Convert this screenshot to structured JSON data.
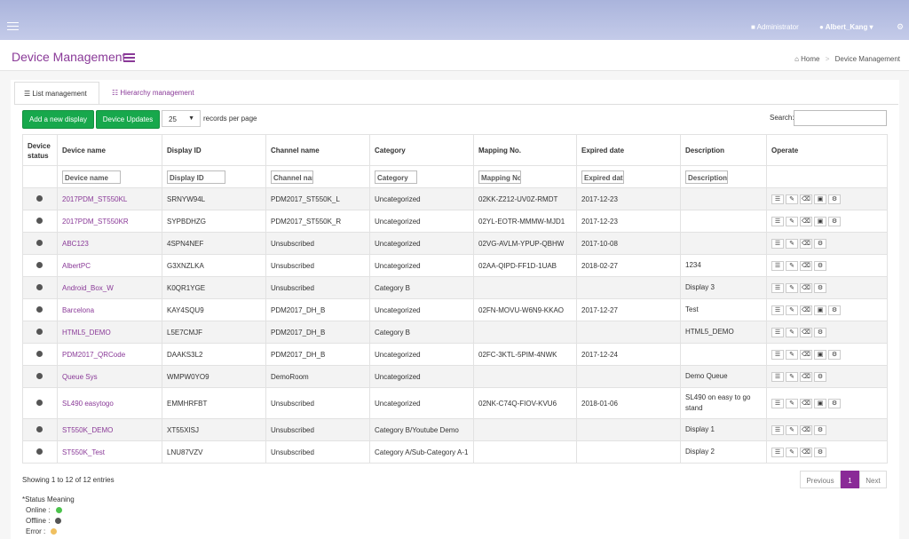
{
  "header": {
    "admin_label": "Administrator",
    "user_label": "Albert_Kang",
    "page_title": "Device Management",
    "breadcrumb": {
      "home": "Home",
      "current": "Device Management"
    }
  },
  "tabs": [
    {
      "label": "List management",
      "active": true
    },
    {
      "label": "Hierarchy management",
      "active": false
    }
  ],
  "toolbar": {
    "add_label": "Add a new display",
    "update_label": "Device Updates",
    "page_size": "25",
    "records_label": "records per page",
    "search_label": "Search:"
  },
  "columns": [
    "Device status",
    "Device name",
    "Display ID",
    "Channel name",
    "Category",
    "Mapping No.",
    "Expired date",
    "Description",
    "Operate"
  ],
  "filters": {
    "name": "Device name",
    "display_id": "Display ID",
    "channel": "Channel name",
    "category": "Category",
    "mapping": "Mapping No.",
    "expired": "Expired date",
    "description": "Description"
  },
  "rows": [
    {
      "name": "2017PDM_ST550KL",
      "display_id": "SRNYW94L",
      "channel": "PDM2017_ST550K_L",
      "category": "Uncategorized",
      "mapping": "02KK-Z212-UV0Z-RMDT",
      "expired": "2017-12-23",
      "description": ""
    },
    {
      "name": "2017PDM_ST550KR",
      "display_id": "SYPBDHZG",
      "channel": "PDM2017_ST550K_R",
      "category": "Uncategorized",
      "mapping": "02YL-EOTR-MMMW-MJD1",
      "expired": "2017-12-23",
      "description": ""
    },
    {
      "name": "ABC123",
      "display_id": "4SPN4NEF",
      "channel": "Unsubscribed",
      "category": "Uncategorized",
      "mapping": "02VG-AVLM-YPUP-QBHW",
      "expired": "2017-10-08",
      "description": ""
    },
    {
      "name": "AlbertPC",
      "display_id": "G3XNZLKA",
      "channel": "Unsubscribed",
      "category": "Uncategorized",
      "mapping": "02AA-QIPD-FF1D-1UAB",
      "expired": "2018-02-27",
      "description": "1234"
    },
    {
      "name": "Android_Box_W",
      "display_id": "K0QR1YGE",
      "channel": "Unsubscribed",
      "category": "Category B",
      "mapping": "",
      "expired": "",
      "description": "Display 3"
    },
    {
      "name": "Barcelona",
      "display_id": "KAY4SQU9",
      "channel": "PDM2017_DH_B",
      "category": "Uncategorized",
      "mapping": "02FN-MOVU-W6N9-KKAO",
      "expired": "2017-12-27",
      "description": "Test"
    },
    {
      "name": "HTML5_DEMO",
      "display_id": "L5E7CMJF",
      "channel": "PDM2017_DH_B",
      "category": "Category B",
      "mapping": "",
      "expired": "",
      "description": "HTML5_DEMO"
    },
    {
      "name": "PDM2017_QRCode",
      "display_id": "DAAKS3L2",
      "channel": "PDM2017_DH_B",
      "category": "Uncategorized",
      "mapping": "02FC-3KTL-5PIM-4NWK",
      "expired": "2017-12-24",
      "description": ""
    },
    {
      "name": "Queue Sys",
      "display_id": "WMPW0YO9",
      "channel": "DemoRoom",
      "category": "Uncategorized",
      "mapping": "",
      "expired": "",
      "description": "Demo Queue"
    },
    {
      "name": "SL490 easytogo",
      "display_id": "EMMHRFBT",
      "channel": "Unsubscribed",
      "category": "Uncategorized",
      "mapping": "02NK-C74Q-FIOV-KVU6",
      "expired": "2018-01-06",
      "description": "SL490 on easy to go stand"
    },
    {
      "name": "ST550K_DEMO",
      "display_id": "XT55XISJ",
      "channel": "Unsubscribed",
      "category": "Category B/Youtube Demo",
      "mapping": "",
      "expired": "",
      "description": "Display 1"
    },
    {
      "name": "ST550K_Test",
      "display_id": "LNU87VZV",
      "channel": "Unsubscribed",
      "category": "Category A/Sub-Category A-1",
      "mapping": "",
      "expired": "",
      "description": "Display 2"
    }
  ],
  "footer": {
    "showing": "Showing 1 to 12 of 12 entries",
    "prev": "Previous",
    "page": "1",
    "next": "Next"
  },
  "legend": {
    "title": "*Status Meaning",
    "online": "Online :",
    "offline": "Offline :",
    "error": "Error :",
    "colors": {
      "online": "#4cc34c",
      "offline": "#555555",
      "error": "#f0c060"
    }
  },
  "colors": {
    "accent": "#8a3a98",
    "button": "#17a84c"
  }
}
